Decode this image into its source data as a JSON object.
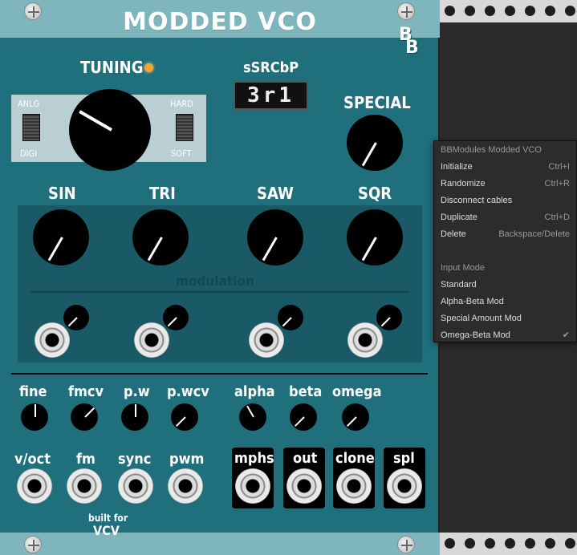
{
  "module": {
    "title": "MODDED VCO",
    "logo": "BB",
    "brand_line1": "built for",
    "brand_line2": "VCV",
    "colors": {
      "panel": "#1f6f7c",
      "panel_light": "#7fb6bd",
      "led": "#f2a33a"
    }
  },
  "tuning": {
    "label": "TUNING",
    "switch_left_top": "ANLG",
    "switch_left_bottom": "DIGI",
    "switch_right_top": "HARD",
    "switch_right_bottom": "SOFT"
  },
  "display": {
    "label": "sSRCbP",
    "value": "3r1"
  },
  "special": {
    "label": "SPECIAL"
  },
  "waves": {
    "sin": "SIN",
    "tri": "TRI",
    "saw": "SAW",
    "sqr": "SQR",
    "modulation": "modulation"
  },
  "small_knobs": {
    "fine": "fine",
    "fmcv": "fmcv",
    "pw": "p.w",
    "pwcv": "p.wcv",
    "alpha": "alpha",
    "beta": "beta",
    "omega": "omega"
  },
  "inputs": {
    "voct": "v/oct",
    "fm": "fm",
    "sync": "sync",
    "pwm": "pwm"
  },
  "outputs": {
    "mphs": "mphs",
    "out": "out",
    "clone": "clone",
    "spl": "spl"
  },
  "context_menu": {
    "header": "BBModules Modded VCO",
    "items": [
      {
        "label": "Initialize",
        "shortcut": "Ctrl+I"
      },
      {
        "label": "Randomize",
        "shortcut": "Ctrl+R"
      },
      {
        "label": "Disconnect cables",
        "shortcut": ""
      },
      {
        "label": "Duplicate",
        "shortcut": "Ctrl+D"
      },
      {
        "label": "Delete",
        "shortcut": "Backspace/Delete"
      }
    ],
    "section_label": "Input Mode",
    "modes": [
      {
        "label": "Standard",
        "check": ""
      },
      {
        "label": "Alpha-Beta Mod",
        "check": ""
      },
      {
        "label": "Special Amount Mod",
        "check": ""
      },
      {
        "label": "Omega-Beta Mod",
        "check": "✔"
      }
    ]
  }
}
